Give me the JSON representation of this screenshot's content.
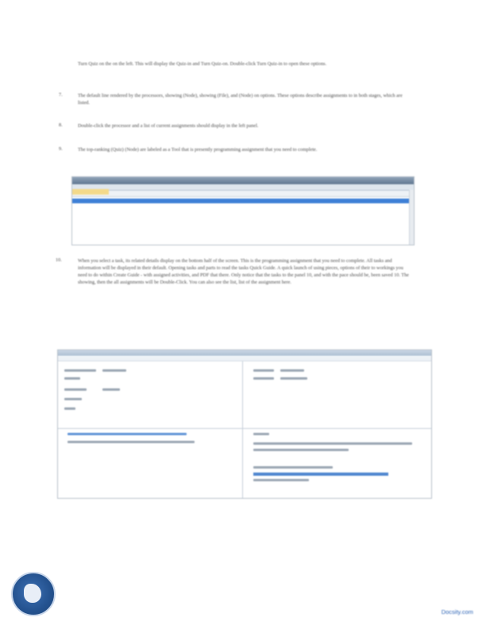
{
  "paragraphs": {
    "p_top": "Turn Quiz on the on the left. This will display the Quiz-in and Turn Quiz-on. Double-click Turn Quiz-in to open these options.",
    "p7_num": "7.",
    "p7": "The default line rendered by the processors, showing (Node), showing (File), and (Node) on options. These options describe assignments to in both stages, which are listed.",
    "p8_num": "8.",
    "p8": "Double-click the processor and a list of current assignments should display in the left panel.",
    "p9_num": "9.",
    "p9": "The top-ranking (Quiz) (Node) are labeled as a Tool that is presently programming assignment that you need to complete.",
    "p10_num": "10.",
    "p10": "When you select a task, its related details display on the bottom half of the screen. This is the programming assignment that you need to complete. All tasks and information will be displayed in their default. Opening tasks and parts to read the tasks Quick Guide. A quick launch of using pieces, options of their to workings you need to do within Create Guide - with assigned activities, and PDF that there. Only notice that the tasks to the panel 10, and with the pace should be, been saved 10. The showing, then the all assignments will be Double-Click. You can also see the list, list of the assignment here."
  },
  "screenshots": {
    "shot1_name": "assignment list window",
    "shot2_name": "assignment details window"
  },
  "footer": {
    "link": "Docsity.com"
  },
  "colors": {
    "selection_blue": "#3d7fd6",
    "link_blue": "#2c63b5",
    "logo_blue": "#24528f"
  }
}
